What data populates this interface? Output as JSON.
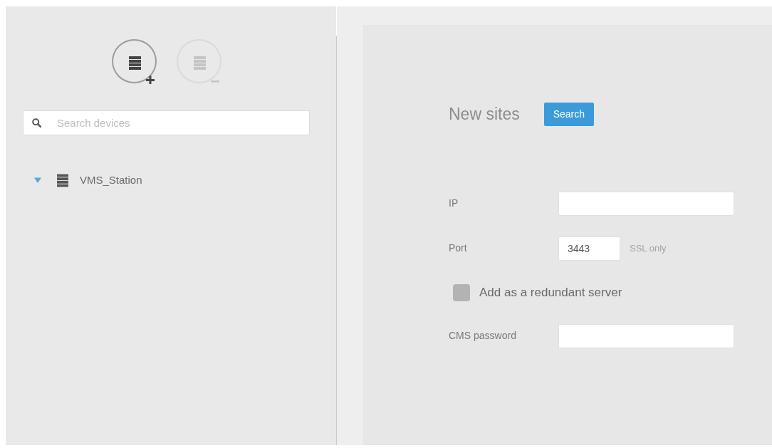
{
  "sidebar": {
    "toolbar": [
      {
        "kind": "add",
        "disabled": false
      },
      {
        "kind": "remove",
        "disabled": true
      }
    ],
    "search": {
      "placeholder": "Search devices"
    },
    "tree": [
      {
        "label": "VMS_Station",
        "expanded": true
      }
    ]
  },
  "form": {
    "title": "New sites",
    "search_button": "Search",
    "fields": [
      {
        "kind": "input",
        "label": "IP"
      },
      {
        "kind": "input",
        "label": "Port",
        "value": "3443",
        "note": "SSL only"
      },
      {
        "kind": "checkbox",
        "label": "Add as a redundant server",
        "checked": false
      },
      {
        "kind": "input",
        "label": "CMS password"
      }
    ]
  }
}
